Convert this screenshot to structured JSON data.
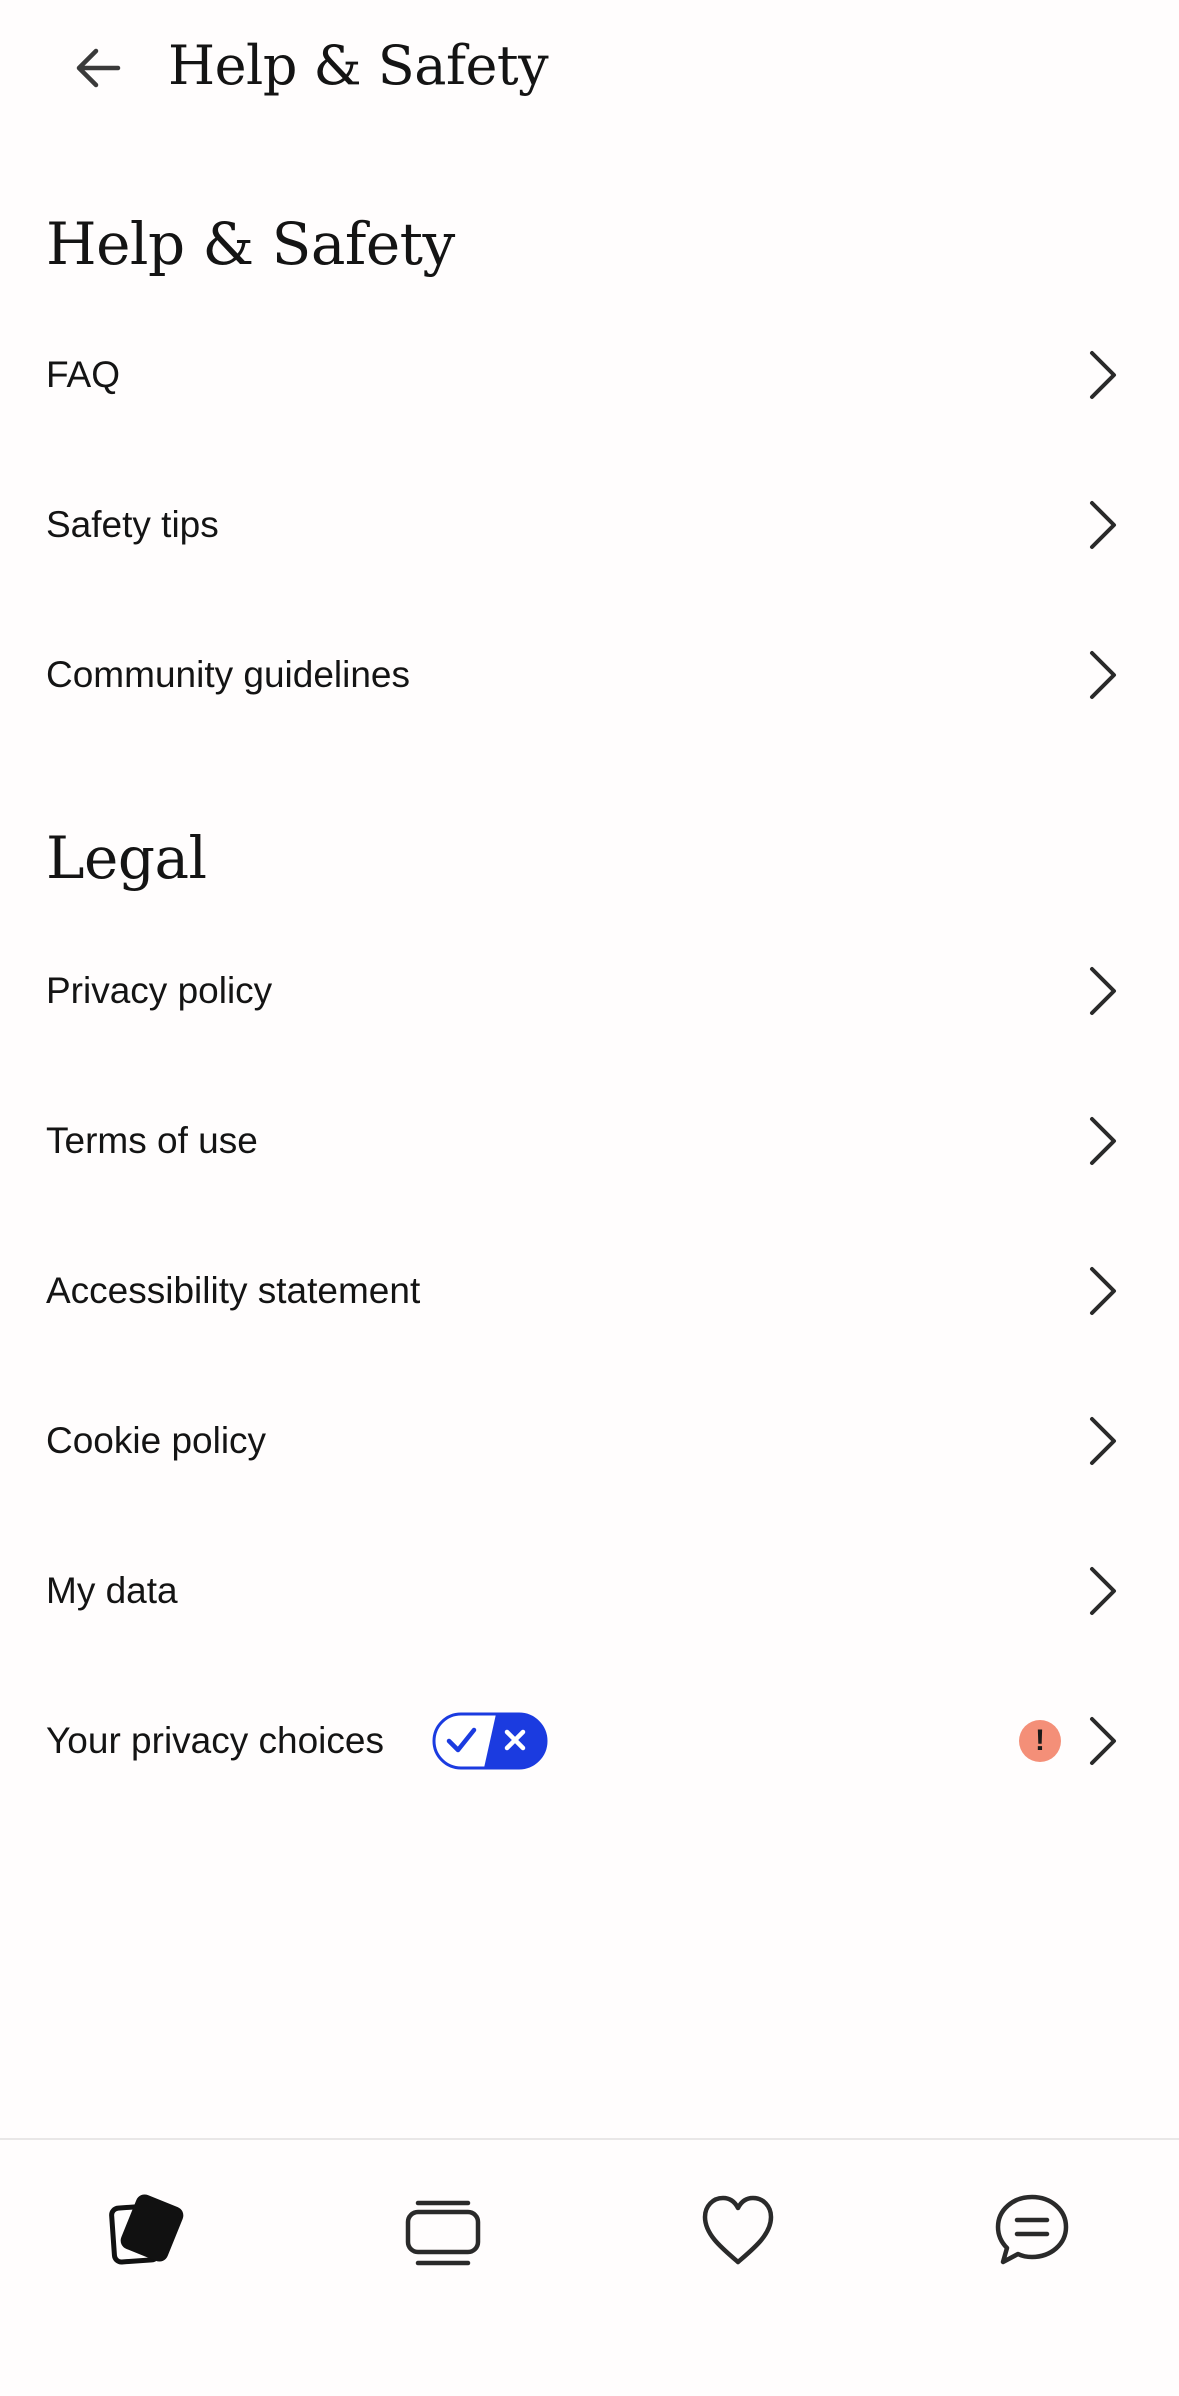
{
  "app_bar": {
    "title": "Help & Safety",
    "back_icon": "arrow-left-icon"
  },
  "sections": {
    "help": {
      "heading": "Help & Safety",
      "items": [
        {
          "label": "FAQ"
        },
        {
          "label": "Safety tips"
        },
        {
          "label": "Community guidelines"
        }
      ]
    },
    "legal": {
      "heading": "Legal",
      "items": [
        {
          "label": "Privacy policy"
        },
        {
          "label": "Terms of use"
        },
        {
          "label": "Accessibility statement"
        },
        {
          "label": "Cookie policy"
        },
        {
          "label": "My data"
        },
        {
          "label": "Your privacy choices",
          "badge": "!"
        }
      ]
    }
  },
  "bottom_nav": [
    {
      "icon": "cards-icon",
      "active": true
    },
    {
      "icon": "stack-icon",
      "active": false
    },
    {
      "icon": "heart-icon",
      "active": false
    },
    {
      "icon": "chat-icon",
      "active": false
    }
  ],
  "colors": {
    "background": "#fffdfd",
    "text": "#141414",
    "toggle_blue": "#1b3be0",
    "alert": "#f48f78",
    "divider": "#e9e7e7"
  }
}
